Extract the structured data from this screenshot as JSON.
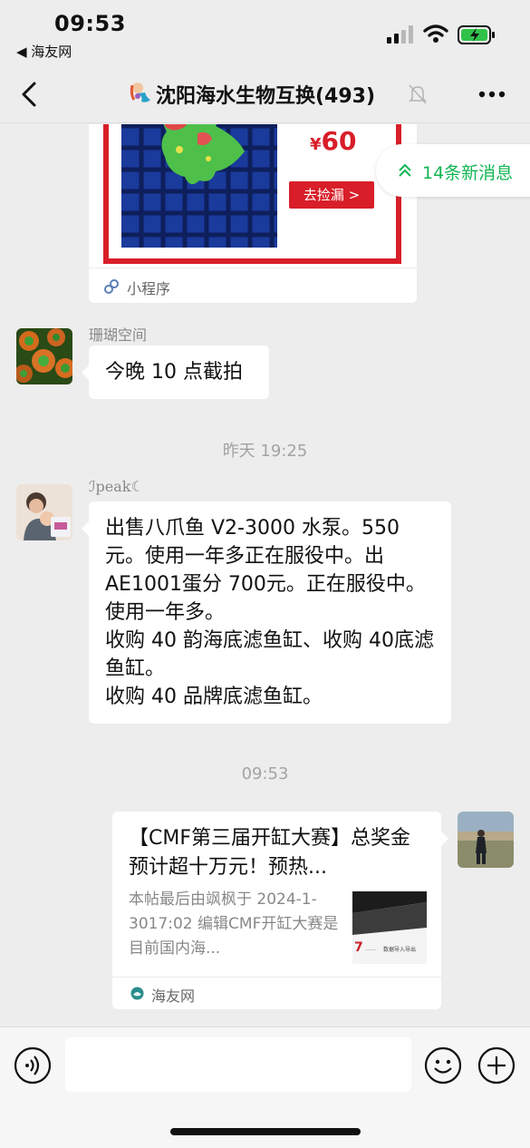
{
  "status_bar": {
    "time": "09:53",
    "back_app": "◀ 海友网"
  },
  "nav": {
    "title": "沈阳海水生物互换(493)"
  },
  "mini_program_card": {
    "price_symbol": "¥",
    "price": "60",
    "button": "去捡漏 >",
    "footer_label": "小程序"
  },
  "new_messages": {
    "label": "14条新消息"
  },
  "messages": [
    {
      "sender": "珊瑚空间",
      "text": "今晚 10 点截拍"
    },
    {
      "sender": "ℐpeak☾",
      "text": "出售八爪鱼 V2-3000 水泵。550元。使用一年多正在服役中。出AE1001蛋分 700元。正在服役中。使用一年多。\n收购 40 韵海底滤鱼缸、收购 40底滤鱼缸。\n收购 40 品牌底滤鱼缸。"
    }
  ],
  "timestamps": {
    "yesterday": "昨天 19:25",
    "today": "09:53"
  },
  "link_card": {
    "title": "【CMF第三届开缸大赛】总奖金预计超十万元！预热...",
    "description": "本帖最后由飒枫于 2024-1-3017:02 编辑CMF开缸大赛是目前国内海...",
    "thumb_text": "数据导入导出",
    "site": "海友网"
  },
  "colors": {
    "accent_green": "#12b553",
    "promo_red": "#d81e28",
    "background": "#ededed"
  }
}
